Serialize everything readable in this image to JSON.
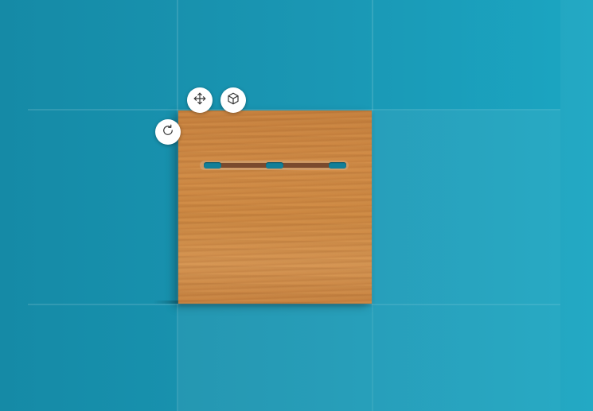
{
  "canvas": {
    "background_colors": [
      "#158aa6",
      "#1ba6c2"
    ]
  },
  "toolbar": {
    "move_icon": "move-arrows-icon",
    "view3d_icon": "cube-3d-icon",
    "rotate_icon": "rotate-clockwise-icon"
  },
  "panel": {
    "material": "oak-wood",
    "color": "#d08b45",
    "hanger_color": "#7a4a2e",
    "slot_color": "#127f98"
  }
}
